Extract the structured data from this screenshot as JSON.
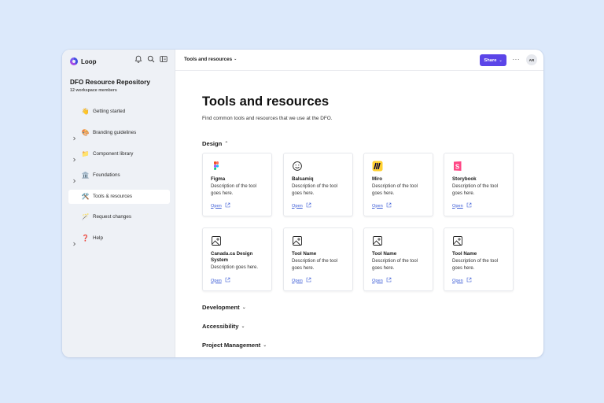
{
  "app": {
    "name": "Loop"
  },
  "workspace": {
    "title": "DFO Resource Repository",
    "members": "12 workspace members"
  },
  "sidebar": {
    "items": [
      {
        "label": "Getting started",
        "emoji": "👋",
        "chevron": false,
        "active": false
      },
      {
        "label": "Branding guidelines",
        "emoji": "🎨",
        "chevron": true,
        "active": false
      },
      {
        "label": "Component library",
        "emoji": "📁",
        "chevron": true,
        "active": false
      },
      {
        "label": "Foundations",
        "emoji": "🏛️",
        "chevron": true,
        "active": false
      },
      {
        "label": "Tools & resources",
        "emoji": "🛠️",
        "chevron": false,
        "active": true
      },
      {
        "label": "Request changes",
        "emoji": "🪄",
        "chevron": false,
        "active": false
      },
      {
        "label": "Help",
        "emoji": "❓",
        "chevron": true,
        "active": false
      }
    ]
  },
  "topbar": {
    "breadcrumb": "Tools and resources",
    "share_label": "Share",
    "avatar_initials": "AR"
  },
  "page": {
    "title": "Tools and resources",
    "description": "Find common tools and resources that we use at the DFO."
  },
  "sections": [
    {
      "label": "Design",
      "expanded": true
    },
    {
      "label": "Development",
      "expanded": false
    },
    {
      "label": "Accessibility",
      "expanded": false
    },
    {
      "label": "Project Management",
      "expanded": false
    }
  ],
  "cards": [
    {
      "name": "Figma",
      "desc_1": "Description of the tool",
      "desc_2": "goes here.",
      "open": "Open",
      "icon": "figma-icon"
    },
    {
      "name": "Balsamiq",
      "desc_1": "Description of the tool",
      "desc_2": "goes here.",
      "open": "Open",
      "icon": "balsamiq-icon"
    },
    {
      "name": "Miro",
      "desc_1": "Description of the tool",
      "desc_2": "goes here.",
      "open": "Open",
      "icon": "miro-icon"
    },
    {
      "name": "Storybook",
      "desc_1": "Description of the tool",
      "desc_2": "goes here.",
      "open": "Open",
      "icon": "storybook-icon"
    },
    {
      "name": "Canada.ca Design System",
      "desc_1": "Description goes here.",
      "desc_2": "",
      "open": "Open",
      "icon": "image-icon"
    },
    {
      "name": "Tool Name",
      "desc_1": "Description of the tool",
      "desc_2": "goes here.",
      "open": "Open",
      "icon": "image-icon"
    },
    {
      "name": "Tool Name",
      "desc_1": "Description of the tool",
      "desc_2": "goes here.",
      "open": "Open",
      "icon": "image-icon"
    },
    {
      "name": "Tool Name",
      "desc_1": "Description of the tool",
      "desc_2": "goes here.",
      "open": "Open",
      "icon": "image-icon"
    }
  ],
  "colors": {
    "accent": "#5b45e8",
    "link": "#3b5bd6",
    "sidebar_bg": "#eef1f6",
    "page_bg": "#dce9fb"
  }
}
